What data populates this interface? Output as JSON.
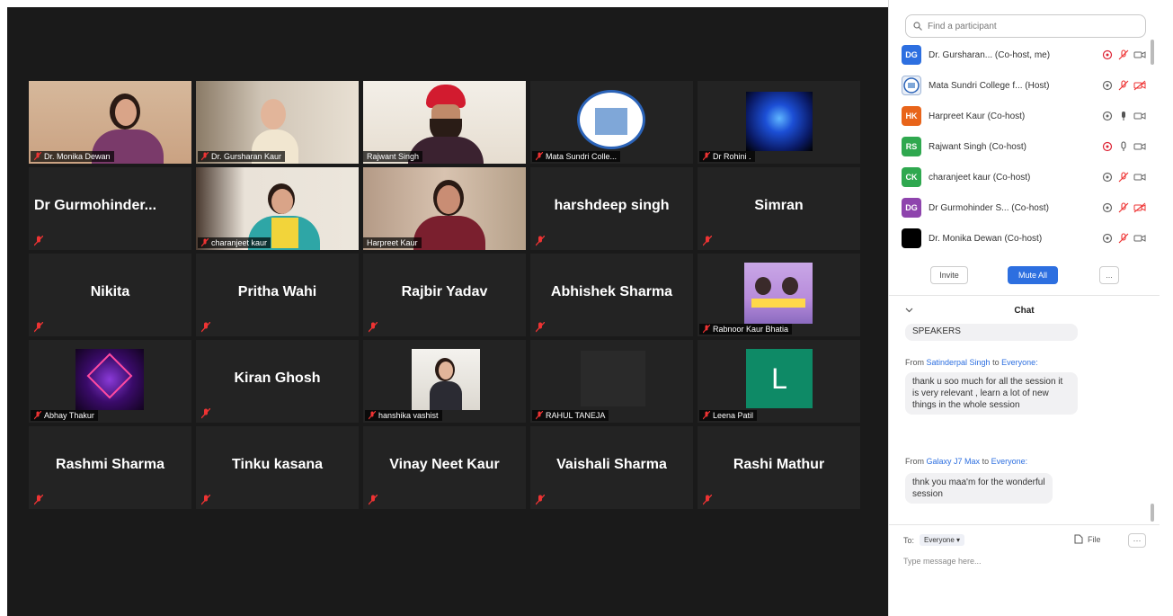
{
  "tiles_big": [
    {
      "name": "Dr  Gurmohinder..."
    },
    {
      "name": "Simran"
    },
    {
      "name": "harshdeep singh"
    },
    {
      "name": "Nikita"
    },
    {
      "name": "Pritha Wahi"
    },
    {
      "name": "Rajbir Yadav"
    },
    {
      "name": "Abhishek Sharma"
    },
    {
      "name": "Kiran Ghosh"
    },
    {
      "name": "Rashmi Sharma"
    },
    {
      "name": "Tinku kasana"
    },
    {
      "name": "Vinay Neet Kaur"
    },
    {
      "name": "Vaishali Sharma"
    },
    {
      "name": "Rashi Mathur"
    }
  ],
  "tiles_video": [
    {
      "caption": "Dr. Monika Dewan"
    },
    {
      "caption": "Dr. Gursharan Kaur"
    },
    {
      "caption": "Rajwant Singh"
    },
    {
      "caption": "Mata Sundri Colle..."
    },
    {
      "caption": "Dr Rohini ."
    },
    {
      "caption": "charanjeet kaur"
    },
    {
      "caption": "Harpreet Kaur"
    },
    {
      "caption": "Rabnoor Kaur Bhatia"
    },
    {
      "caption": "Abhay Thakur"
    },
    {
      "caption": "hanshika vashist"
    },
    {
      "caption": "RAHUL TANEJA"
    },
    {
      "caption": "Leena Patil"
    }
  ],
  "leena_initial": "L",
  "panel": {
    "search_placeholder": "Find a participant",
    "participants": [
      {
        "initials": "DG",
        "color": "#2d6fe0",
        "name": "Dr. Gursharan... (Co-host, me)"
      },
      {
        "initials": "",
        "color": "#ffffff",
        "name": "Mata Sundri College f... (Host)"
      },
      {
        "initials": "HK",
        "color": "#e8641a",
        "name": "Harpreet Kaur (Co-host)"
      },
      {
        "initials": "RS",
        "color": "#2fa84f",
        "name": "Rajwant Singh (Co-host)"
      },
      {
        "initials": "CK",
        "color": "#2fa84f",
        "name": "charanjeet kaur (Co-host)"
      },
      {
        "initials": "DG",
        "color": "#8e44ad",
        "name": "Dr Gurmohinder S... (Co-host)"
      },
      {
        "initials": "",
        "color": "#000000",
        "name": "Dr. Monika Dewan (Co-host)"
      }
    ],
    "invite_label": "Invite",
    "mute_all_label": "Mute All",
    "more_label": "...",
    "chat_title": "Chat",
    "messages": [
      {
        "text": "SPEAKERS"
      },
      {
        "from": "From",
        "sender": "Satinderpal Singh",
        "to": "to",
        "recipient": "Everyone:",
        "text": "thank u soo much for all the session it is very relevant , learn a lot of new things in the whole session"
      },
      {
        "from": "From",
        "sender": "Galaxy J7 Max",
        "to": "to",
        "recipient": "Everyone:",
        "text": "thnk you maa'm for the wonderful session"
      }
    ],
    "to_label": "To:",
    "to_value": "Everyone",
    "file_label": "File",
    "more2_label": "···",
    "message_placeholder": "Type message here..."
  }
}
